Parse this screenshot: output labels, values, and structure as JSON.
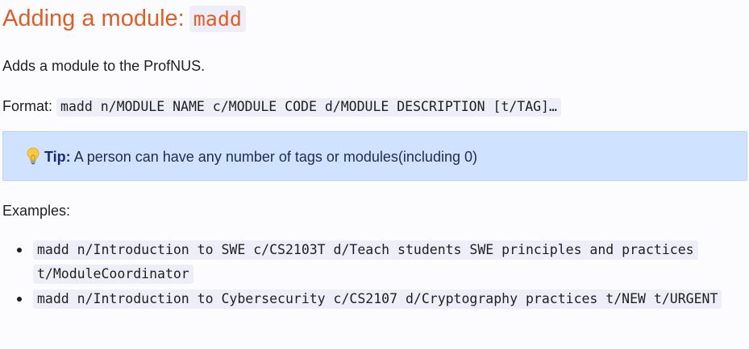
{
  "section": {
    "title": "Adding a module:",
    "command": "madd"
  },
  "description": "Adds a module to the ProfNUS.",
  "format": {
    "label": "Format:",
    "syntax": "madd n/MODULE NAME c/MODULE CODE d/MODULE DESCRIPTION [t/TAG]…"
  },
  "tip": {
    "icon": "lightbulb-icon",
    "label": "Tip:",
    "text": "A person can have any number of tags or modules(including 0)",
    "colors": {
      "background": "#cfe2ff",
      "label": "#16297a"
    }
  },
  "examples": {
    "label": "Examples:",
    "items": [
      "madd n/Introduction to SWE c/CS2103T d/Teach students SWE principles and practices t/ModuleCoordinator",
      "madd n/Introduction to Cybersecurity c/CS2107 d/Cryptography practices t/NEW t/URGENT"
    ]
  },
  "colors": {
    "heading": "#e05d26",
    "code_background": "#eeeef8"
  }
}
